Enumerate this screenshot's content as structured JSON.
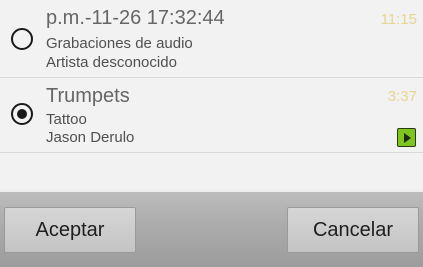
{
  "tracks": [
    {
      "title": "p.m.-11-26 17:32:44",
      "album": "Grabaciones de audio",
      "artist": "Artista desconocido",
      "duration": "11:15",
      "selected": false
    },
    {
      "title": "Trumpets",
      "album": "Tattoo",
      "artist": "Jason Derulo",
      "duration": "3:37",
      "selected": true
    }
  ],
  "icons": {
    "play": "play-icon"
  },
  "buttons": {
    "accept_label": "Aceptar",
    "cancel_label": "Cancelar"
  },
  "colors": {
    "duration": "#e8d590",
    "play_badge": "#7dc521"
  }
}
